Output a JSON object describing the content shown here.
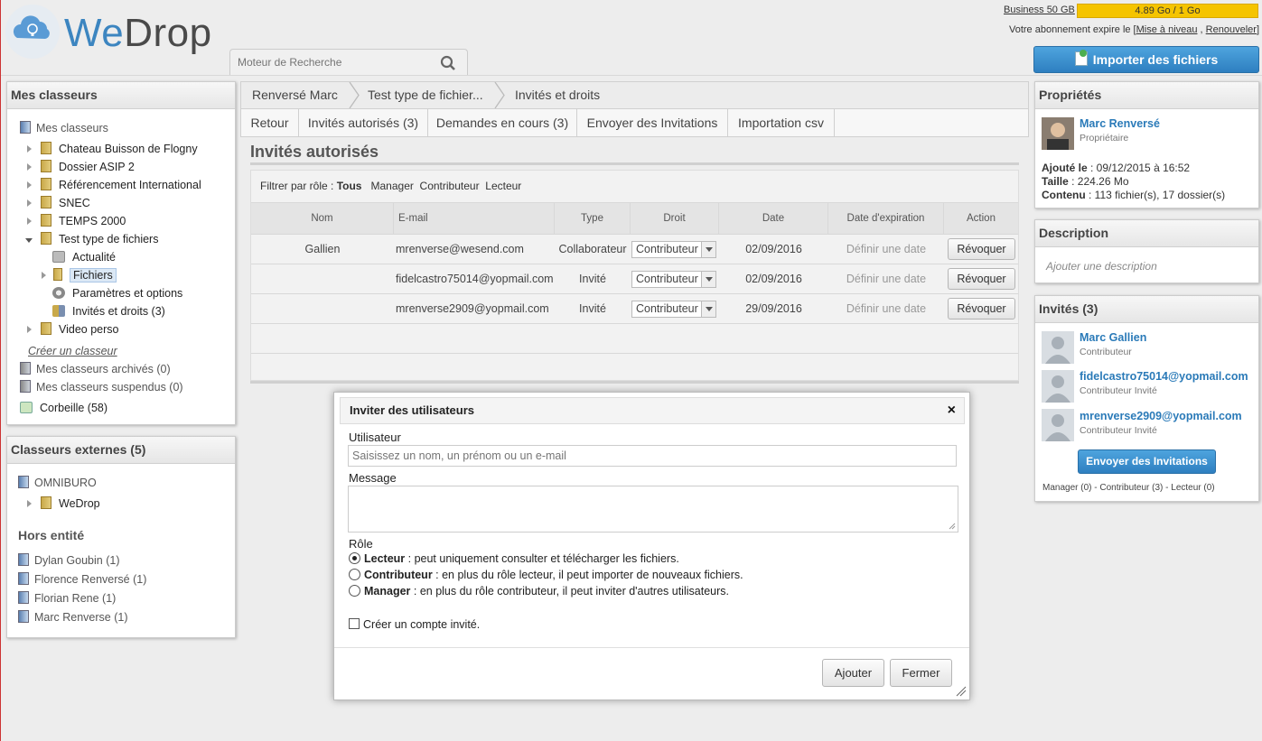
{
  "header": {
    "logo_we": "We",
    "logo_drop": "Drop",
    "search_placeholder": "Moteur de Recherche",
    "plan_label": "Business 50 GB",
    "quota_text": "4.89 Go / 1 Go",
    "expire_text": "Votre abonnement expire le [",
    "expire_upgrade": "Mise à niveau",
    "expire_sep": " , ",
    "expire_renew": "Renouveler",
    "expire_end": "]",
    "import_label": "Importer des fichiers"
  },
  "left": {
    "title": "Mes classeurs",
    "root": "Mes classeurs",
    "items": [
      {
        "label": "Chateau Buisson de Flogny"
      },
      {
        "label": "Dossier ASIP 2"
      },
      {
        "label": "Référencement International"
      },
      {
        "label": "SNEC"
      },
      {
        "label": "TEMPS 2000"
      },
      {
        "label": "Test type de fichiers"
      },
      {
        "label": "Actualité"
      },
      {
        "label": "Fichiers"
      },
      {
        "label": "Paramètres et options"
      },
      {
        "label": "Invités et droits (3)"
      },
      {
        "label": "Video perso"
      }
    ],
    "create_link": "Créer un classeur",
    "archived": "Mes classeurs archivés (0)",
    "suspended": "Mes classeurs suspendus (0)",
    "trash": "Corbeille (58)"
  },
  "external": {
    "title": "Classeurs externes (5)",
    "org": "OMNIBURO",
    "org_item": "WeDrop",
    "hors_title": "Hors entité",
    "people": [
      "Dylan Goubin (1)",
      "Florence Renversé (1)",
      "Florian Rene (1)",
      "Marc Renverse (1)"
    ]
  },
  "breadcrumb": [
    "Renversé Marc",
    "Test type de fichier...",
    "Invités et droits"
  ],
  "tabs": [
    "Retour",
    "Invités autorisés (3)",
    "Demandes en cours (3)",
    "Envoyer des Invitations",
    "Importation csv"
  ],
  "page_title": "Invités autorisés",
  "filter": {
    "label": "Filtrer par rôle",
    "colon": " : ",
    "all": "Tous",
    "manager": "Manager",
    "contrib": "Contributeur",
    "reader": "Lecteur"
  },
  "table": {
    "headers": [
      "Nom",
      "E-mail",
      "Type",
      "Droit",
      "Date",
      "Date d'expiration",
      "Action"
    ],
    "rows": [
      {
        "nom": "Gallien",
        "email": "mrenverse@wesend.com",
        "type": "Collaborateur",
        "droit": "Contributeur",
        "date": "02/09/2016",
        "exp": "Définir une date",
        "action": "Révoquer"
      },
      {
        "nom": "",
        "email": "fidelcastro75014@yopmail.com",
        "type": "Invité",
        "droit": "Contributeur",
        "date": "02/09/2016",
        "exp": "Définir une date",
        "action": "Révoquer"
      },
      {
        "nom": "",
        "email": "mrenverse2909@yopmail.com",
        "type": "Invité",
        "droit": "Contributeur",
        "date": "29/09/2016",
        "exp": "Définir une date",
        "action": "Révoquer"
      }
    ]
  },
  "dialog": {
    "title": "Inviter des utilisateurs",
    "close": "×",
    "user_label": "Utilisateur",
    "user_placeholder": "Saisissez un nom, un prénom ou un e-mail",
    "message_label": "Message",
    "role_label": "Rôle",
    "roles": [
      {
        "name": "Lecteur",
        "desc": " : peut uniquement consulter et télécharger les fichiers."
      },
      {
        "name": "Contributeur",
        "desc": " : en plus du rôle lecteur, il peut importer de nouveaux fichiers."
      },
      {
        "name": "Manager",
        "desc": " : en plus du rôle contributeur, il peut inviter d'autres utilisateurs."
      }
    ],
    "guest_account": "Créer un compte invité.",
    "add": "Ajouter",
    "close_btn": "Fermer"
  },
  "props": {
    "title": "Propriétés",
    "owner": "Marc Renversé",
    "owner_role": "Propriétaire",
    "added_label": "Ajouté le",
    "added_value": " : 09/12/2015 à 16:52",
    "size_label": "Taille",
    "size_value": " : 224.26 Mo",
    "content_label": "Contenu",
    "content_value": " : 113 fichier(s), 17 dossier(s)"
  },
  "description": {
    "title": "Description",
    "placeholder": "Ajouter une description"
  },
  "guests": {
    "title": "Invités (3)",
    "list": [
      {
        "name": "Marc Gallien",
        "role": "Contributeur"
      },
      {
        "name": "fidelcastro75014@yopmail.com",
        "role": "Contributeur Invité"
      },
      {
        "name": "mrenverse2909@yopmail.com",
        "role": "Contributeur Invité"
      }
    ],
    "send_btn": "Envoyer des Invitations",
    "summary": "Manager (0) - Contributeur (3) - Lecteur (0)"
  },
  "colors": {
    "accent": "#2a7ab8",
    "quota": "#f5c400",
    "button": "#3a8fd0"
  }
}
